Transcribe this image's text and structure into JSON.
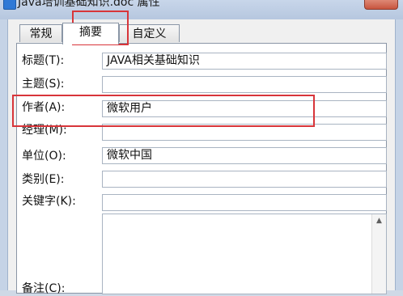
{
  "window": {
    "title": "Java培训基础知识.doc 属性"
  },
  "tabs": [
    {
      "label": "常规"
    },
    {
      "label": "摘要"
    },
    {
      "label": "自定义"
    }
  ],
  "fields": [
    {
      "label": "标题(T):",
      "value": "JAVA相关基础知识"
    },
    {
      "label": "主题(S):",
      "value": ""
    },
    {
      "label": "作者(A):",
      "value": "微软用户"
    },
    {
      "label": "经理(M):",
      "value": ""
    },
    {
      "label": "单位(O):",
      "value": "微软中国"
    },
    {
      "label": "类别(E):",
      "value": ""
    },
    {
      "label": "关键字(K):",
      "value": ""
    }
  ],
  "comments": {
    "label": "备注(C):",
    "scroll_up_glyph": "▲"
  },
  "colors": {
    "highlight": "#d8353a",
    "accent": "#2f79d6"
  }
}
